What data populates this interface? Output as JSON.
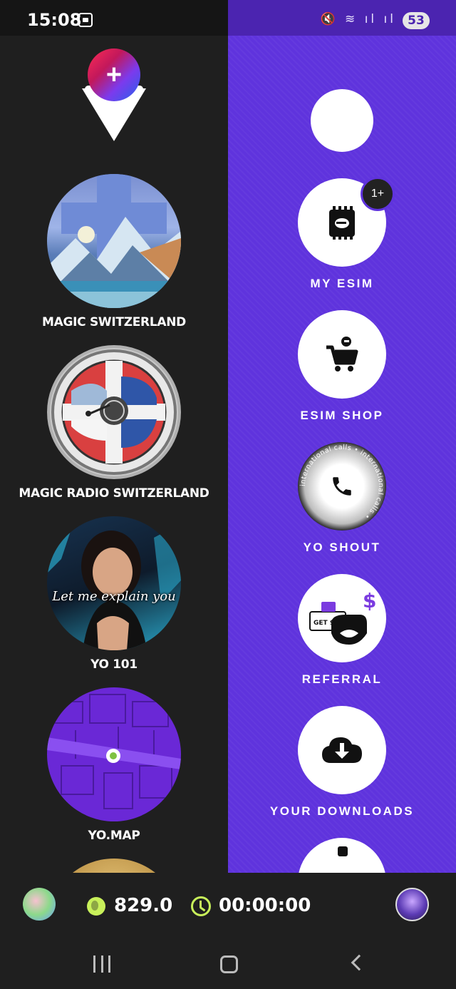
{
  "status_bar": {
    "time": "15:08",
    "icons": "🔇 ≋ ıl ıl",
    "battery": "53"
  },
  "add_button": {
    "label": "+"
  },
  "left_tiles": [
    {
      "label": "MAGIC SWITZERLAND"
    },
    {
      "label": "MAGIC RADIO SWITZERLAND"
    },
    {
      "label": "YO 101",
      "overlay": "Let me explain you"
    },
    {
      "label": "YO.MAP"
    }
  ],
  "right_menu": [
    {
      "label": ""
    },
    {
      "label": "MY ESIM",
      "badge": "1+"
    },
    {
      "label": "ESIM SHOP"
    },
    {
      "label": "YO SHOUT",
      "ring_text": "international calls • international calls •"
    },
    {
      "label": "REFERRAL",
      "coupon": "GET $10",
      "dollar": "$"
    },
    {
      "label": "YOUR DOWNLOADS"
    }
  ],
  "bottom_bar": {
    "coins": "829.0",
    "timer": "00:00:00"
  },
  "colors": {
    "accent": "#5f33dd",
    "lime": "#c8f05a",
    "dark": "#1f1f1f"
  }
}
